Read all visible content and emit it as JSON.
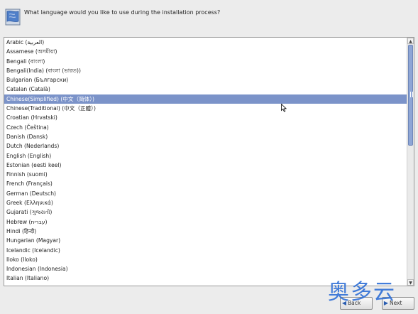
{
  "header": {
    "prompt": "What language would you like to use during the installation process?"
  },
  "languages": [
    "Arabic (العربية)",
    "Assamese (অসমীয়া)",
    "Bengali (বাংলা)",
    "Bengali(India) (বাংলা (ভারত))",
    "Bulgarian (Български)",
    "Catalan (Català)",
    "Chinese(Simplified) (中文（简体）)",
    "Chinese(Traditional) (中文（正體）)",
    "Croatian (Hrvatski)",
    "Czech (Čeština)",
    "Danish (Dansk)",
    "Dutch (Nederlands)",
    "English (English)",
    "Estonian (eesti keel)",
    "Finnish (suomi)",
    "French (Français)",
    "German (Deutsch)",
    "Greek (Ελληνικά)",
    "Gujarati (ગુજરાતી)",
    "Hebrew (עברית)",
    "Hindi (हिन्दी)",
    "Hungarian (Magyar)",
    "Icelandic (Icelandic)",
    "Iloko (Iloko)",
    "Indonesian (Indonesia)",
    "Italian (Italiano)"
  ],
  "selected_language": "Chinese(Simplified) (中文（简体）)",
  "buttons": {
    "back_label": "Back",
    "next_label": "Next"
  },
  "watermark": "奥多云",
  "icons": {
    "globe": "globe-flag-icon",
    "scroll_up": "scroll-up-arrow-icon",
    "scroll_down": "scroll-down-arrow-icon",
    "back": "back-arrow-icon",
    "next": "next-arrow-icon",
    "cursor": "mouse-pointer-icon"
  }
}
